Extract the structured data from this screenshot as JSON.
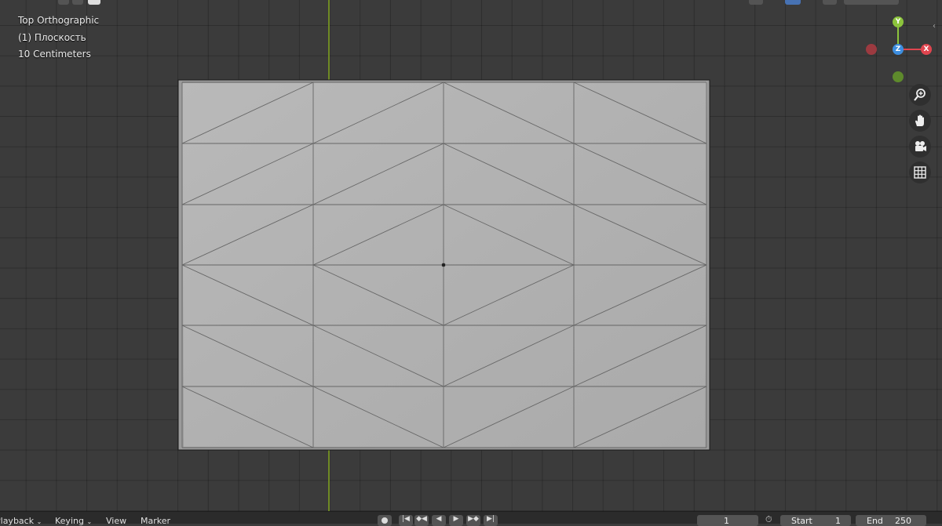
{
  "viewport": {
    "view_name": "Top Orthographic",
    "object_label": "(1) Плоскость",
    "grid_scale": "10 Centimeters"
  },
  "gizmo": {
    "y_label": "Y",
    "z_label": "Z",
    "x_label": "X",
    "colors": {
      "x": "#e0454f",
      "y": "#8cc43c",
      "z": "#3d8ee0"
    }
  },
  "nav_icons": [
    "zoom-icon",
    "pan-hand-icon",
    "camera-icon",
    "grid-ortho-icon"
  ],
  "timeline": {
    "menus": [
      "Playback",
      "Keying",
      "View",
      "Marker"
    ],
    "current_frame": "1",
    "start_label": "Start",
    "start_value": "1",
    "end_label": "End",
    "end_value": "250"
  }
}
